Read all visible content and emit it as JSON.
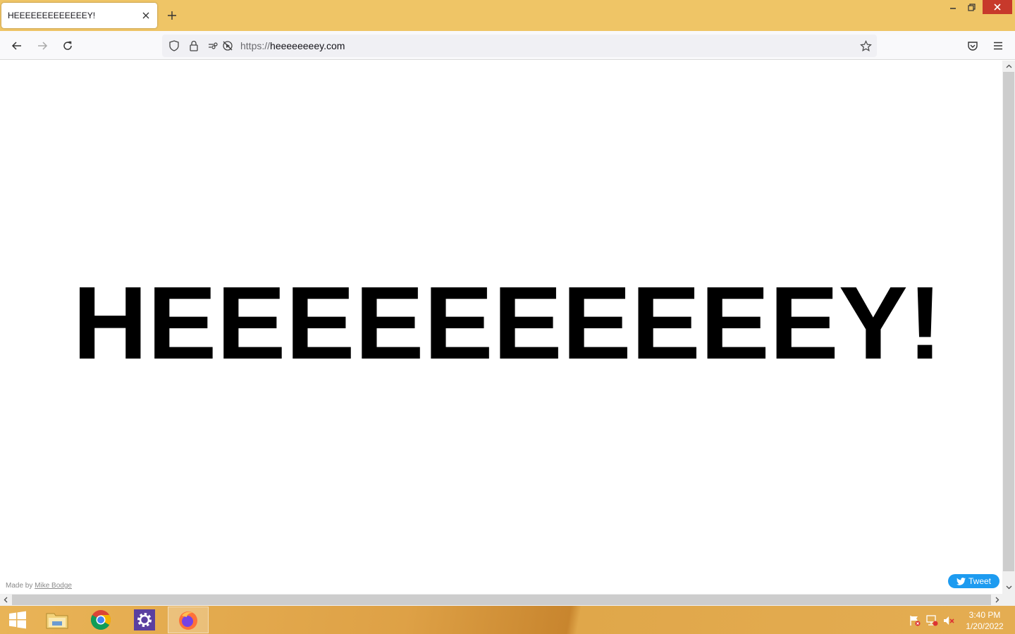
{
  "browser": {
    "tab": {
      "title": "HEEEEEEEEEEEEEY!"
    },
    "address_bar": {
      "protocol": "https://",
      "domain": "heeeeeeeey.com"
    },
    "window_controls": [
      "minimize",
      "restore",
      "close"
    ]
  },
  "page": {
    "headline": "HEEEEEEEEEEY!",
    "credit_prefix": "Made by ",
    "credit_link": "Mike Bodge",
    "tweet_label": "Tweet"
  },
  "taskbar": {
    "apps": [
      {
        "name": "File Explorer",
        "icon": "folder-icon"
      },
      {
        "name": "Google Chrome",
        "icon": "chrome-icon"
      },
      {
        "name": "Settings",
        "icon": "gear-icon"
      },
      {
        "name": "Firefox",
        "icon": "firefox-icon"
      }
    ],
    "clock": {
      "time": "3:40 PM",
      "date": "1/20/2022"
    }
  },
  "colors": {
    "titlebar": "#efc566",
    "tweet": "#1d9bf0",
    "close": "#c7392b"
  }
}
